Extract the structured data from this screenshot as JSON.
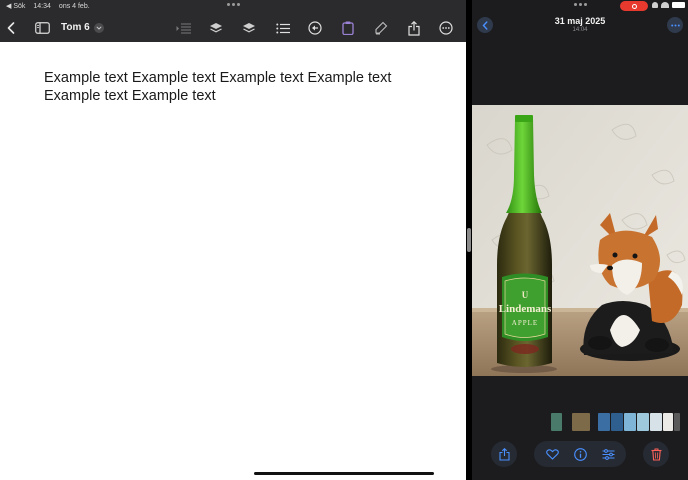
{
  "left_app": {
    "status": {
      "back_app": "◀ Sök",
      "time": "14:34",
      "date": "ons 4 feb."
    },
    "toolbar": {
      "title": "Tom 6",
      "icons": [
        "chevron-left-icon",
        "sidebar-icon",
        "indent-icon",
        "layers-icon",
        "layers-alt-icon",
        "list-icon",
        "undo-icon",
        "page-icon",
        "pen-icon",
        "share-icon",
        "more-icon"
      ]
    },
    "document": {
      "text": "Example text Example text Example text Example text Example text Example text"
    }
  },
  "right_app": {
    "header": {
      "date": "31 maj 2025",
      "time": "14:04"
    },
    "photo": {
      "label_brand": "Lindemans",
      "label_flavor": "APPLE"
    },
    "bottom_actions": [
      "share-icon",
      "heart-icon",
      "info-icon",
      "adjust-icon",
      "trash-icon"
    ],
    "colors": {
      "accent": "#4a90ff",
      "recording": "#e8392f",
      "trash": "#ff6159"
    }
  }
}
